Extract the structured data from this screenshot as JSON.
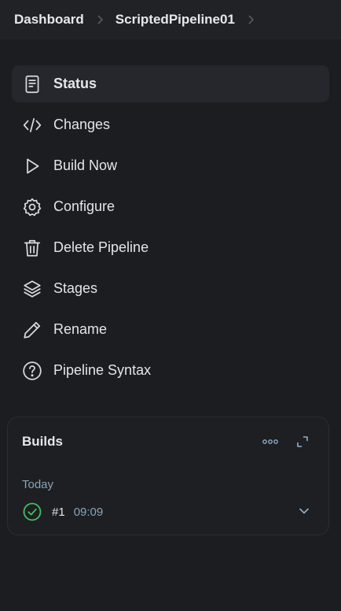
{
  "breadcrumb": {
    "items": [
      "Dashboard",
      "ScriptedPipeline01"
    ]
  },
  "nav": {
    "items": [
      {
        "label": "Status",
        "icon": "document-icon",
        "active": true
      },
      {
        "label": "Changes",
        "icon": "code-icon"
      },
      {
        "label": "Build Now",
        "icon": "play-icon"
      },
      {
        "label": "Configure",
        "icon": "gear-icon"
      },
      {
        "label": "Delete Pipeline",
        "icon": "trash-icon"
      },
      {
        "label": "Stages",
        "icon": "layers-icon"
      },
      {
        "label": "Rename",
        "icon": "pencil-icon"
      },
      {
        "label": "Pipeline Syntax",
        "icon": "help-icon"
      }
    ]
  },
  "builds": {
    "title": "Builds",
    "group_label": "Today",
    "items": [
      {
        "number": "#1",
        "time": "09:09",
        "status": "success"
      }
    ]
  },
  "colors": {
    "background": "#1c1d20",
    "topbar": "#212226",
    "active_item": "#26272c",
    "success": "#3fbf62",
    "muted_text": "#8aa3b8"
  }
}
